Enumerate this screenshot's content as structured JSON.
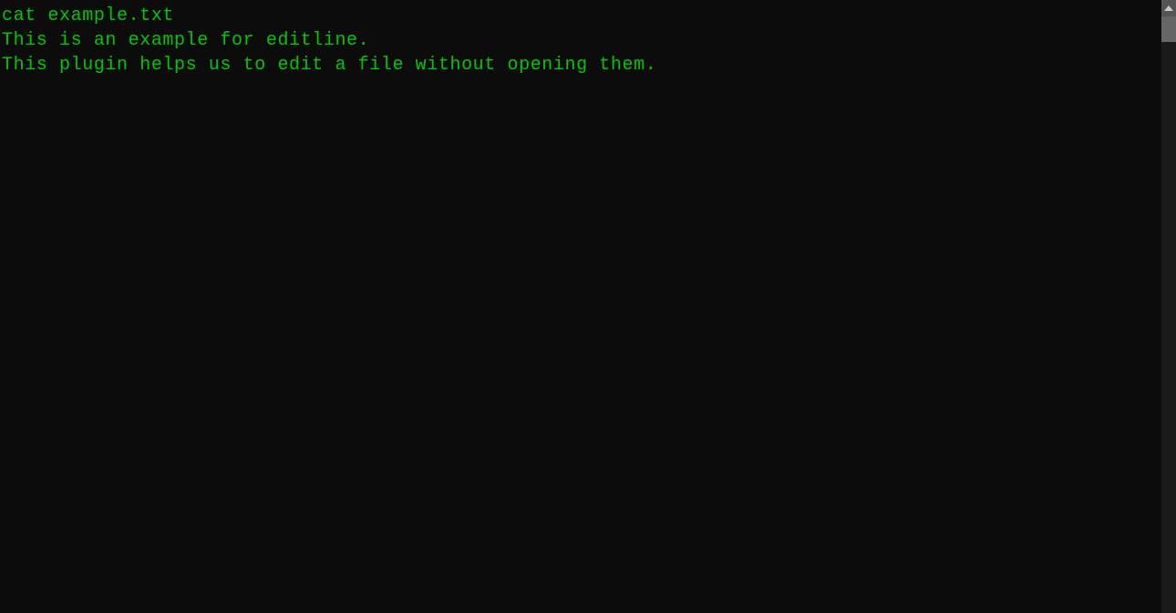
{
  "terminal": {
    "lines": [
      "cat example.txt",
      "This is an example for editline.",
      "This plugin helps us to edit a file without opening them.",
      "",
      "",
      "",
      "",
      "",
      "",
      "",
      "",
      "",
      "",
      "",
      "",
      "",
      "",
      "",
      "",
      "",
      ""
    ]
  },
  "scrollbar": {
    "up_arrow_label": "▲"
  },
  "colors": {
    "background": "#0c0c0c",
    "text": "#00c800",
    "scrollbar_track": "#1a1a1a",
    "scrollbar_thumb": "#666666",
    "scrollbar_arrow_bg": "#555555"
  }
}
